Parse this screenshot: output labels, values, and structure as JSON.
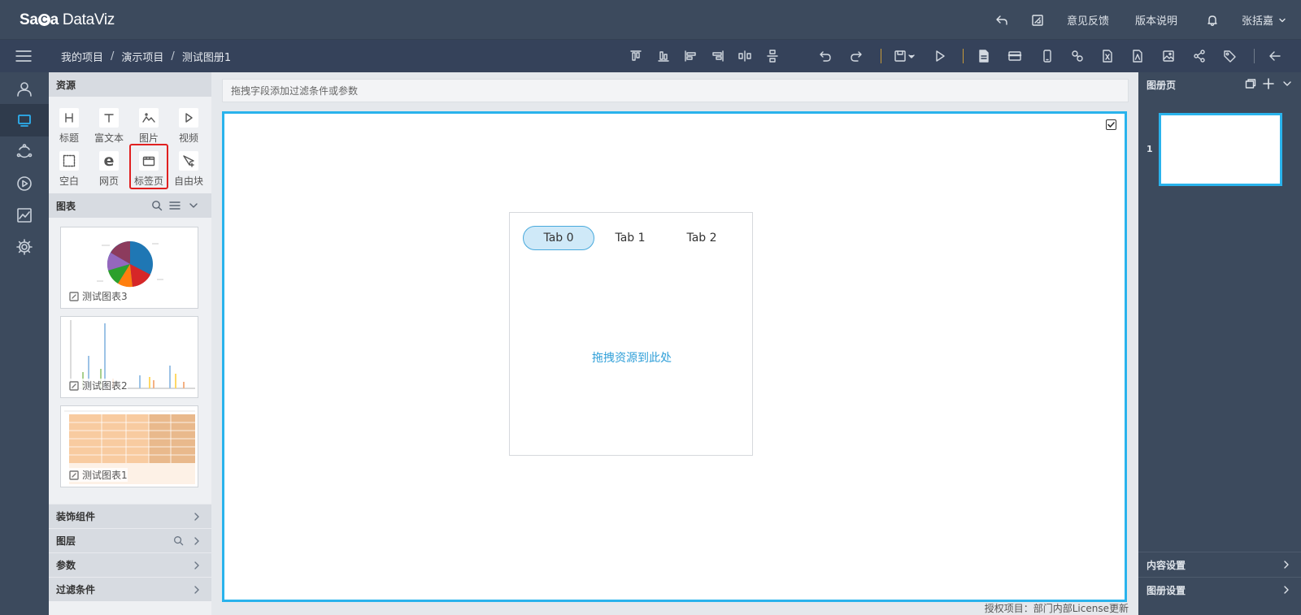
{
  "app": {
    "logo_part1": "Sa",
    "logo_part2": "C",
    "logo_part3": "a",
    "logo_product": "DataViz"
  },
  "topbar": {
    "feedback": "意见反馈",
    "version": "版本说明",
    "user": "张括嘉"
  },
  "breadcrumb": [
    "我的项目",
    "演示项目",
    "测试图册1"
  ],
  "breadcrumb_separator": "/",
  "toolbar_icons": [
    "align-top-icon",
    "align-bottom-icon",
    "align-left-icon",
    "align-right-icon",
    "distribute-horizontal-icon",
    "distribute-vertical-icon",
    "undo-icon",
    "redo-icon",
    "save-icon",
    "play-icon",
    "new-page-icon",
    "card-icon",
    "mobile-icon",
    "link-icon",
    "export-excel-icon",
    "export-pdf-icon",
    "export-image-icon",
    "share-icon",
    "tag-icon",
    "back-arrow-icon"
  ],
  "leftnav": [
    "user-icon",
    "monitor-icon",
    "cycle-icon",
    "play-circle-icon",
    "chart-line-icon",
    "settings-icon"
  ],
  "resources": {
    "title": "资源",
    "items": [
      {
        "label": "标题",
        "icon": "heading-icon"
      },
      {
        "label": "富文本",
        "icon": "text-icon"
      },
      {
        "label": "图片",
        "icon": "image-icon"
      },
      {
        "label": "视频",
        "icon": "video-icon"
      },
      {
        "label": "空白",
        "icon": "blank-icon"
      },
      {
        "label": "网页",
        "icon": "web-icon"
      },
      {
        "label": "标签页",
        "icon": "tab-page-icon"
      },
      {
        "label": "自由块",
        "icon": "free-block-icon"
      }
    ]
  },
  "charts": {
    "title": "图表",
    "items": [
      {
        "label": "测试图表3"
      },
      {
        "label": "测试图表2"
      },
      {
        "label": "测试图表1"
      }
    ]
  },
  "sections": [
    {
      "label": "装饰组件"
    },
    {
      "label": "图层"
    },
    {
      "label": "参数"
    },
    {
      "label": "过滤条件"
    }
  ],
  "canvas": {
    "filter_placeholder": "拖拽字段添加过滤条件或参数",
    "tabs": [
      "Tab 0",
      "Tab 1",
      "Tab 2"
    ],
    "active_tab": "Tab 0",
    "drop_hint": "拖拽资源到此处",
    "license": "授权项目：部门内部License更新"
  },
  "right_panel": {
    "title": "图册页",
    "page_number": "1",
    "content_settings": "内容设置",
    "album_settings": "图册设置"
  },
  "colors": {
    "accent": "#29b3ec",
    "topbar": "#3c4a5d",
    "highlight": "#e02020"
  }
}
